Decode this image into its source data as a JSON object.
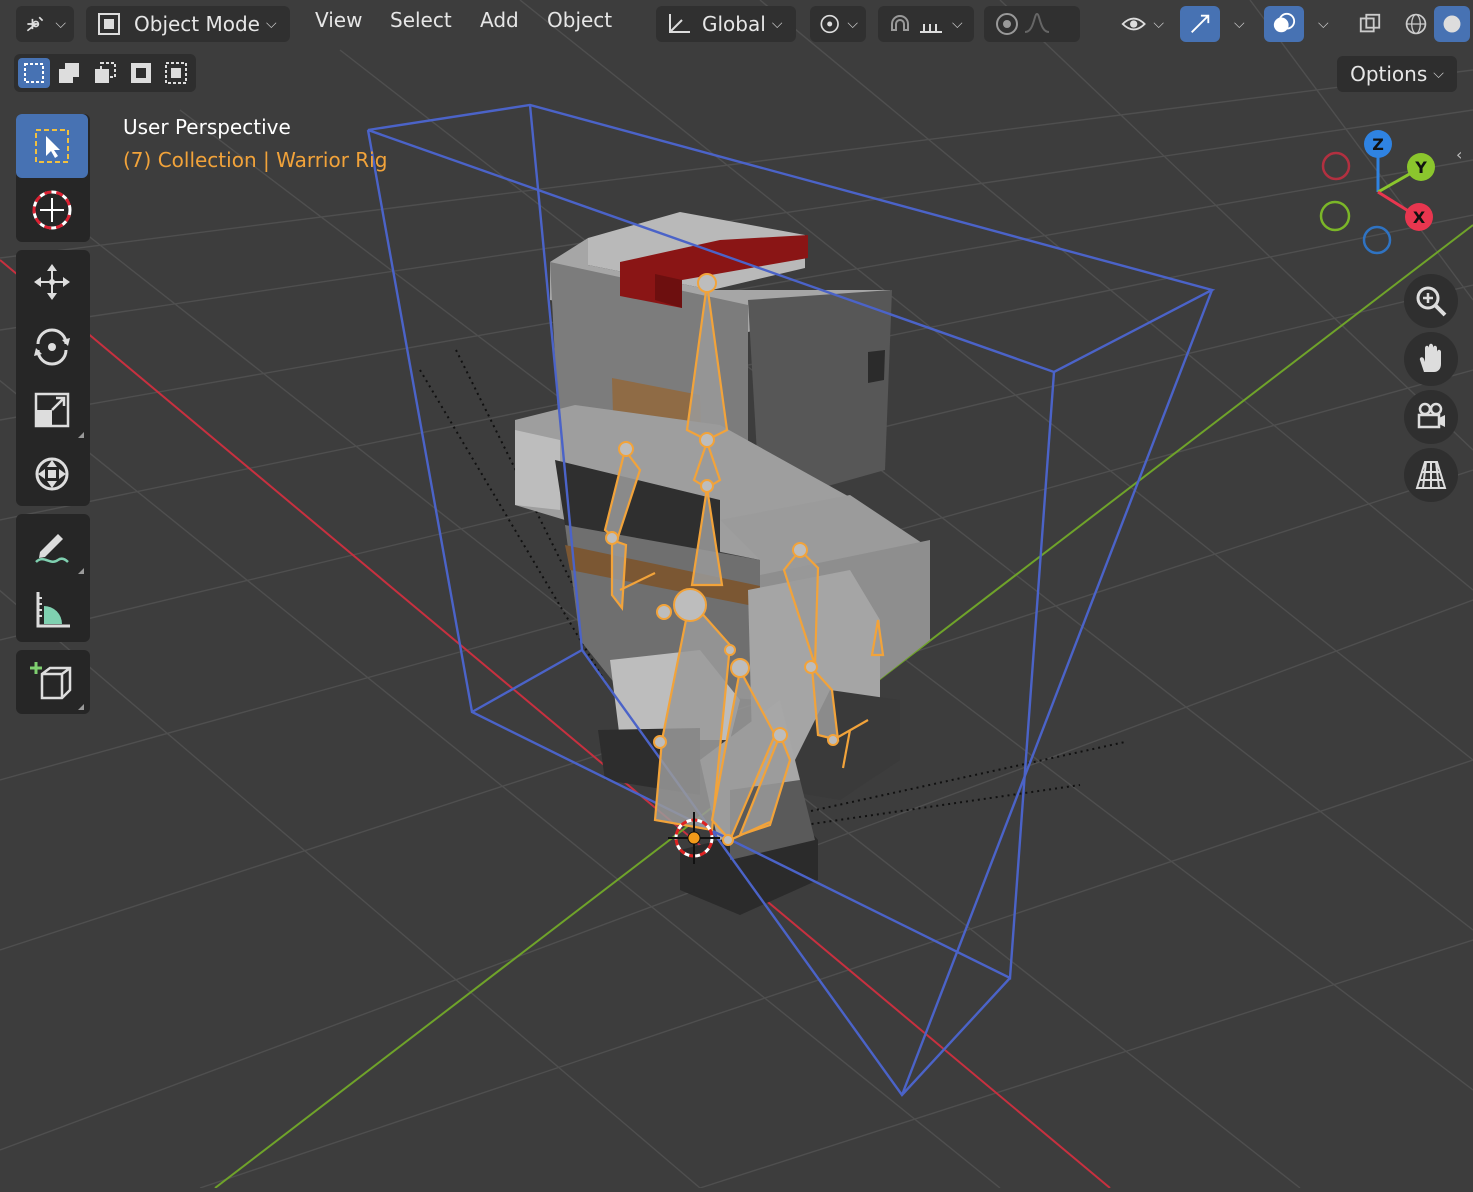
{
  "header": {
    "mode_label": "Object Mode",
    "menus": [
      "View",
      "Select",
      "Add",
      "Object"
    ],
    "orientation_label": "Global",
    "options_label": "Options"
  },
  "viewport": {
    "perspective_label": "User Perspective",
    "collection_label": "(7) Collection | Warrior Rig"
  },
  "gizmo": {
    "axis_labels": {
      "z": "Z",
      "y": "Y",
      "x": "X"
    },
    "colors": {
      "x": "#e8364f",
      "y": "#8bc62d",
      "z": "#2f83e2"
    }
  },
  "toolbar": {
    "tools": [
      "select-box",
      "cursor",
      "move",
      "rotate",
      "scale",
      "transform",
      "annotate",
      "measure",
      "add-cube"
    ]
  },
  "colors": {
    "accent": "#4772b3",
    "selection": "#f2a33a",
    "bounds": "#4b63c8",
    "x_axis": "#c8303f",
    "y_axis": "#6fa32a"
  }
}
